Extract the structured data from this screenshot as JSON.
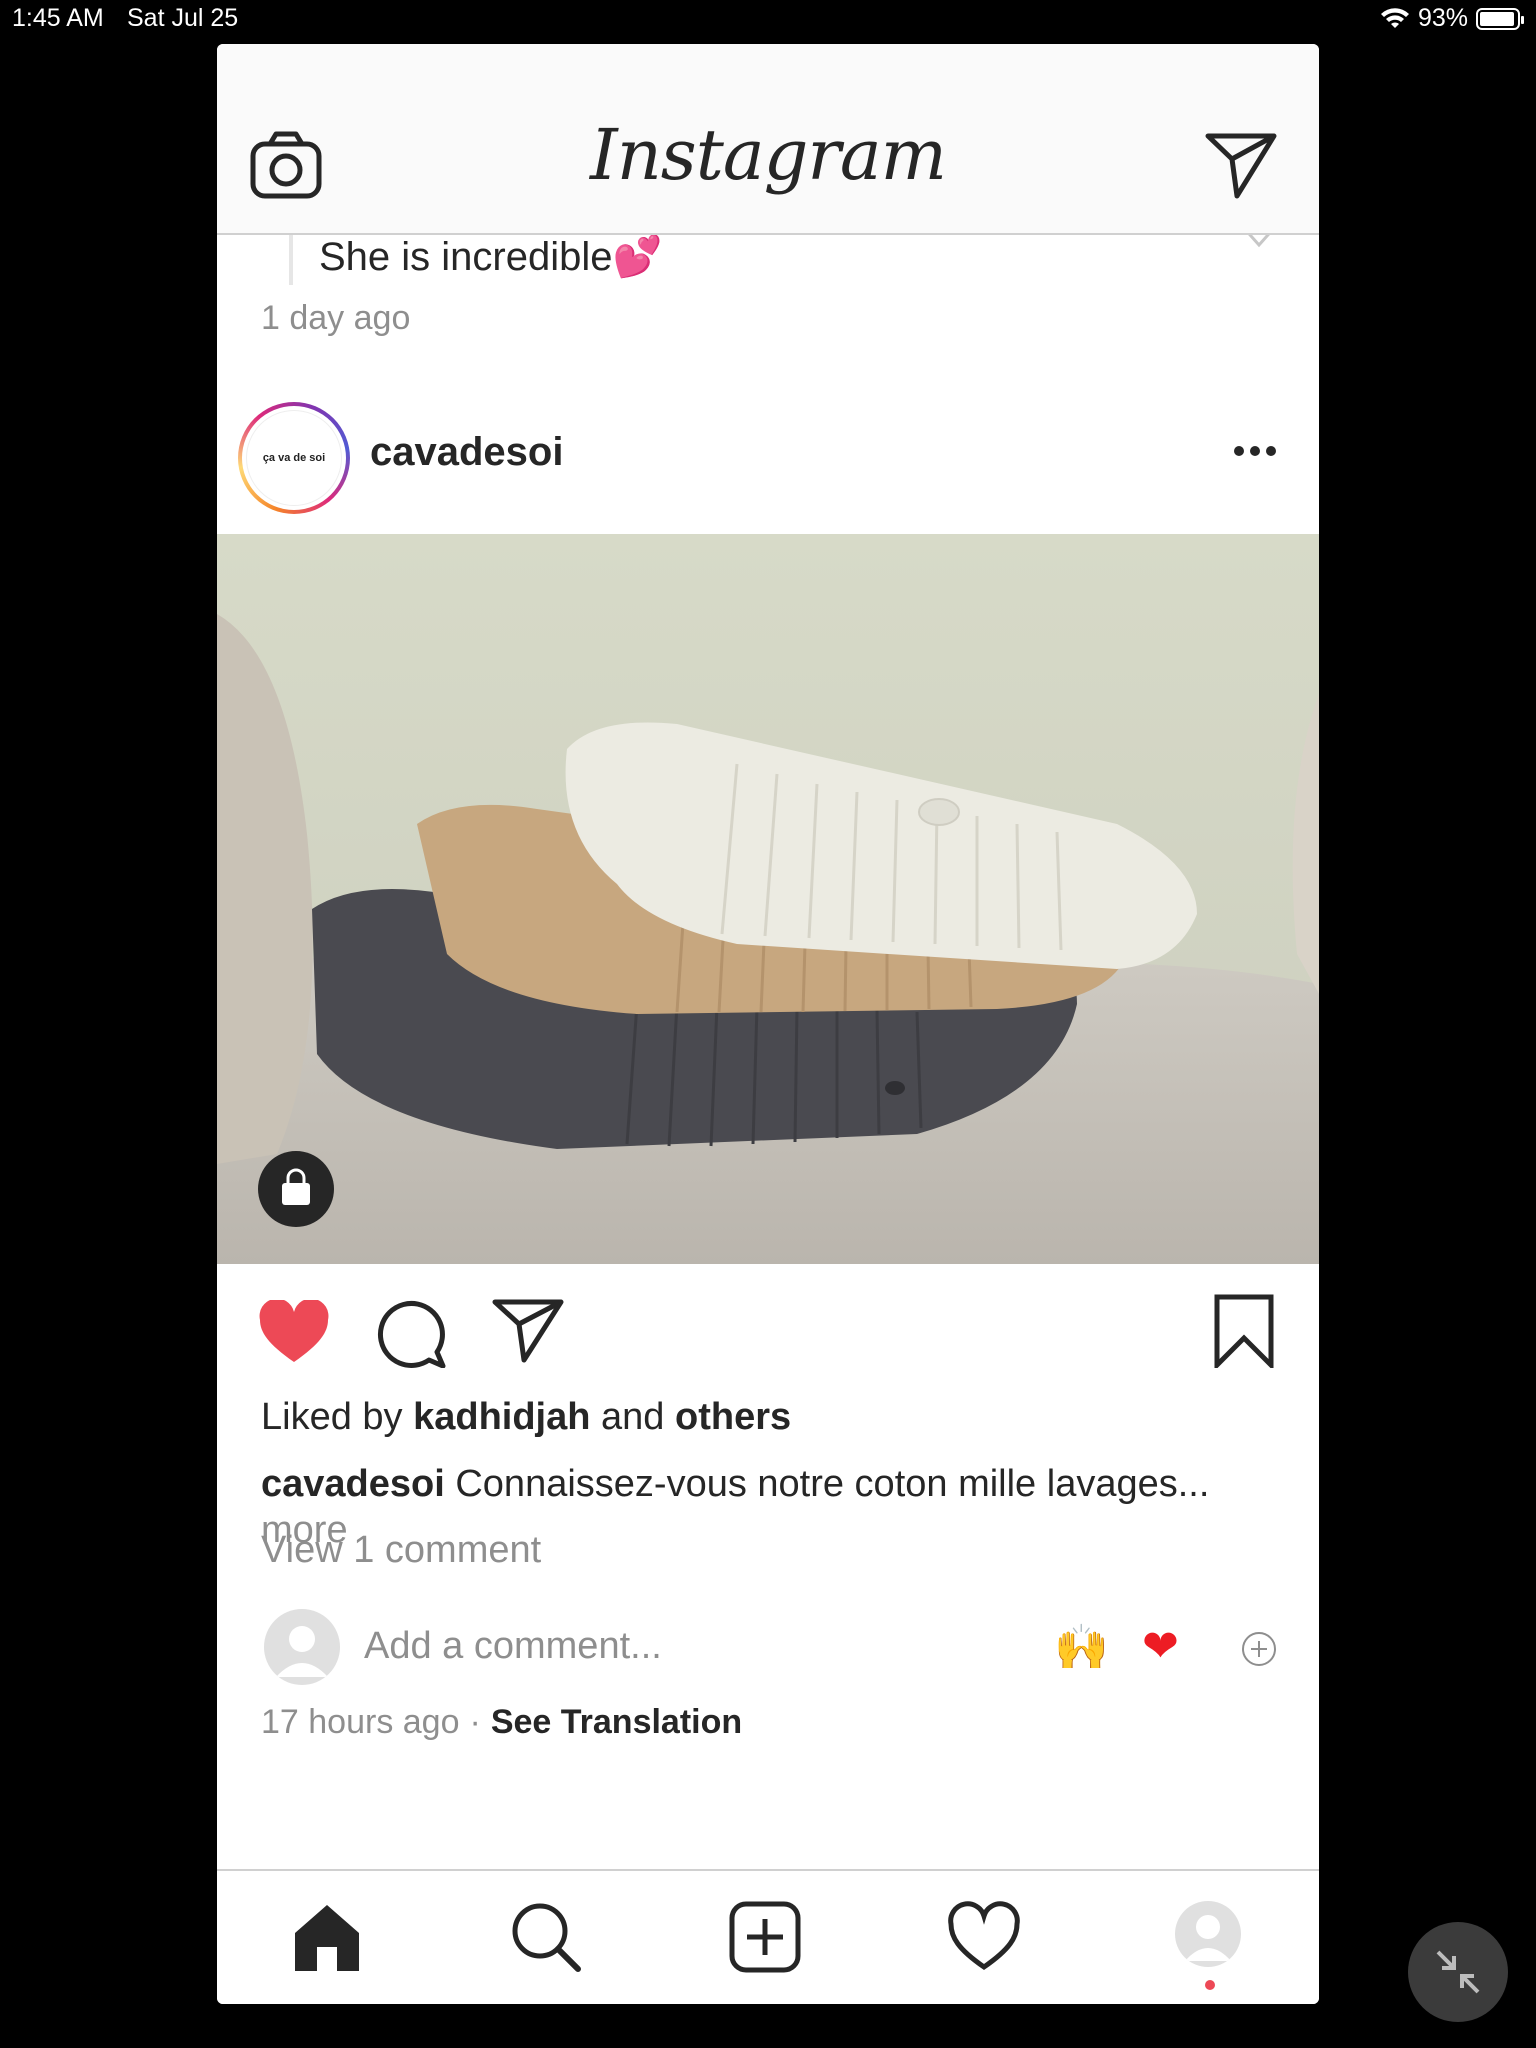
{
  "status_bar": {
    "time": "1:45 AM",
    "date": "Sat Jul 25",
    "battery": "93%",
    "battery_level": 0.93
  },
  "header": {
    "logo": "Instagram",
    "camera_icon": "camera-icon",
    "direct_icon": "paper-plane-icon"
  },
  "previous_post": {
    "comment_text": "She is incredible💕",
    "time": "1 day ago"
  },
  "post": {
    "username": "cavadesoi",
    "avatar_text": "ça va de soi",
    "liked_prefix": "Liked by ",
    "liked_user": "kadhidjah",
    "liked_and": " and ",
    "liked_others": "others",
    "caption_user": "cavadesoi",
    "caption_text": " Connaissez-vous notre coton mille lavages...",
    "caption_more": " more",
    "view_comments": "View 1 comment",
    "comment_placeholder": "Add a comment...",
    "quick_emoji_1": "🙌",
    "quick_emoji_2": "❤",
    "time_ago": "17 hours ago",
    "separator": "·",
    "see_translation": "See Translation",
    "liked": true
  },
  "tabbar": {
    "items": [
      "home-icon",
      "search-icon",
      "add-post-icon",
      "activity-heart-icon",
      "profile-avatar"
    ]
  },
  "colors": {
    "like_red": "#ed4956",
    "text": "#262626",
    "muted": "#8e8e8e"
  }
}
